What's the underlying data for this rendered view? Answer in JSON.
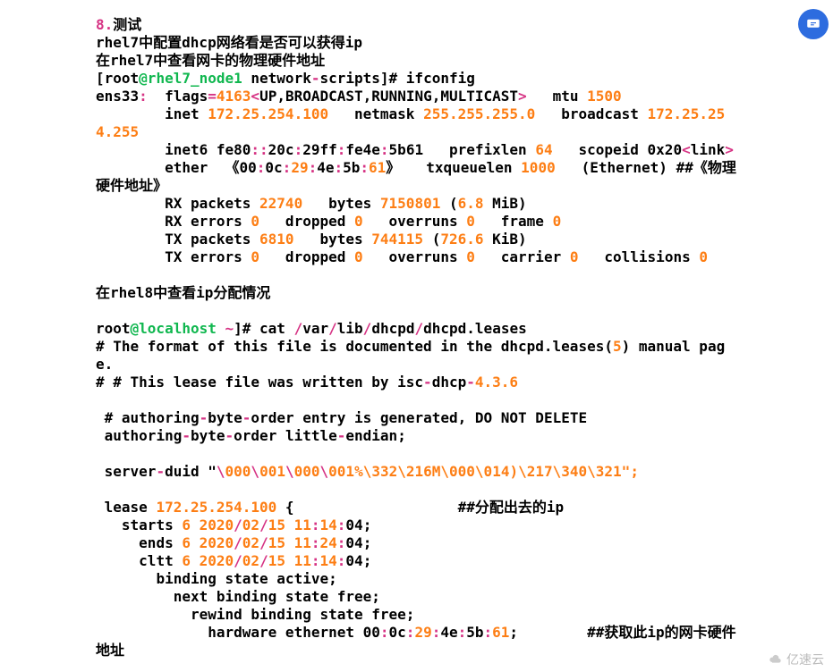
{
  "t": {
    "h1a": "8.",
    "h1b": "测试",
    "l1": "rhel7中配置dhcp网络看是否可以获得ip",
    "l2": "在rhel7中查看网卡的物理硬件地址",
    "root1a": "[root",
    "root1b": "@rhel7_node1",
    "root1c": " network",
    "dash": "-",
    "root1d": "scripts]# ifconfig",
    "ens": "ens33",
    "colon": ":",
    "flags": "  flags",
    "eq": "=",
    "v4163": "4163",
    "lt": "<",
    "upb": "UP,BROADCAST,RUNNING,MULTICAST",
    "gt": ">",
    "mtu": "   mtu ",
    "v1500": "1500",
    "sp8": "        inet ",
    "ip1": "172.25.254.100",
    "netmask": "   netmask ",
    "mask": "255.255.255.0",
    "bcast": "   broadcast ",
    "ip2": "172.25.254.255",
    "inet6a": "        inet6 fe80",
    "cc": "::",
    "c": ":",
    "i6b": "20c",
    "i6c": "29ff",
    "i6d": "fe4e",
    "i6e": "5b61   prefixlen ",
    "v64": "64",
    "scopeid": "   scopeid 0x20",
    "link": "link",
    "ether1": "        ether  《00",
    "e0c": "0c",
    "e29": "29",
    "e4e": "4e",
    "e5b": "5b",
    "e61": "61",
    "etherend": "》   txqueuelen ",
    "v1000": "1000",
    "ethlabel": "   (Ethernet) ##《物理硬件地址》",
    "rx1a": "        RX packets ",
    "v22740": "22740",
    "bytes1": "   bytes ",
    "v7150801": "7150801",
    "par68": " (",
    "v6_8": "6.8",
    "mib": " MiB)",
    "rx2a": "        RX errors ",
    "v0": "0",
    "drop": "   dropped ",
    "overr": "   overruns ",
    "frame": "   frame ",
    "tx1a": "        TX packets ",
    "v6810": "6810",
    "v744115": "744115",
    "par726": " (",
    "v726_6": "726.6",
    "kib": " KiB)",
    "tx2a": "        TX errors ",
    "carr": "   carrier ",
    "coll": "   collisions ",
    "l3": "在rhel8中查看ip分配情况",
    "root2a": "root",
    "root2b": "@localhost ",
    "tilde": "~",
    "root2c": "]# cat ",
    "sl": "/",
    "var": "var",
    "lib": "lib",
    "dhcpd": "dhcpd",
    "leases": "dhcpd.leases",
    "cmt1": "# The format of this file is documented in the dhcpd.leases(",
    "v5": "5",
    "cmt1b": ") manual page.",
    "cmt2a": "# # This lease file was written by isc",
    "cmt2b": "dhcp",
    "cmt2c": "4.3.6",
    "auth1a": " # authoring",
    "auth1b": "byte",
    "auth1c": "order entry is generated, DO NOT DELETE",
    "auth2a": " authoring",
    "auth2b": "byte",
    "auth2c": "order little",
    "auth2d": "endian;",
    "srv1": " server",
    "srv2": "duid \"",
    "bs": "\\",
    "s000": "000",
    "s001": "001",
    "srvend": "%\\332\\216M\\000\\014)\\217\\340\\321\";",
    "lease": " lease ",
    "leaseip": "172.25.254.100",
    "leaseb": " {                   ##分配出去的ip",
    "starts": "   starts ",
    "v6": "6",
    "sp": " ",
    "v2020": "2020",
    "v02": "02",
    "v15": "15",
    "v11": "11",
    "v14": "14",
    "v04": "04;",
    "ends": "     ends ",
    "v24": "24",
    "cltt": "     cltt ",
    "bind1": "       binding state active;",
    "bind2": "         next binding state free;",
    "bind3": "           rewind binding state free;",
    "hw1": "             hardware ethernet 00",
    "hwend": ";        ##获取此ip的网卡硬件地址"
  },
  "watermark": "亿速云"
}
